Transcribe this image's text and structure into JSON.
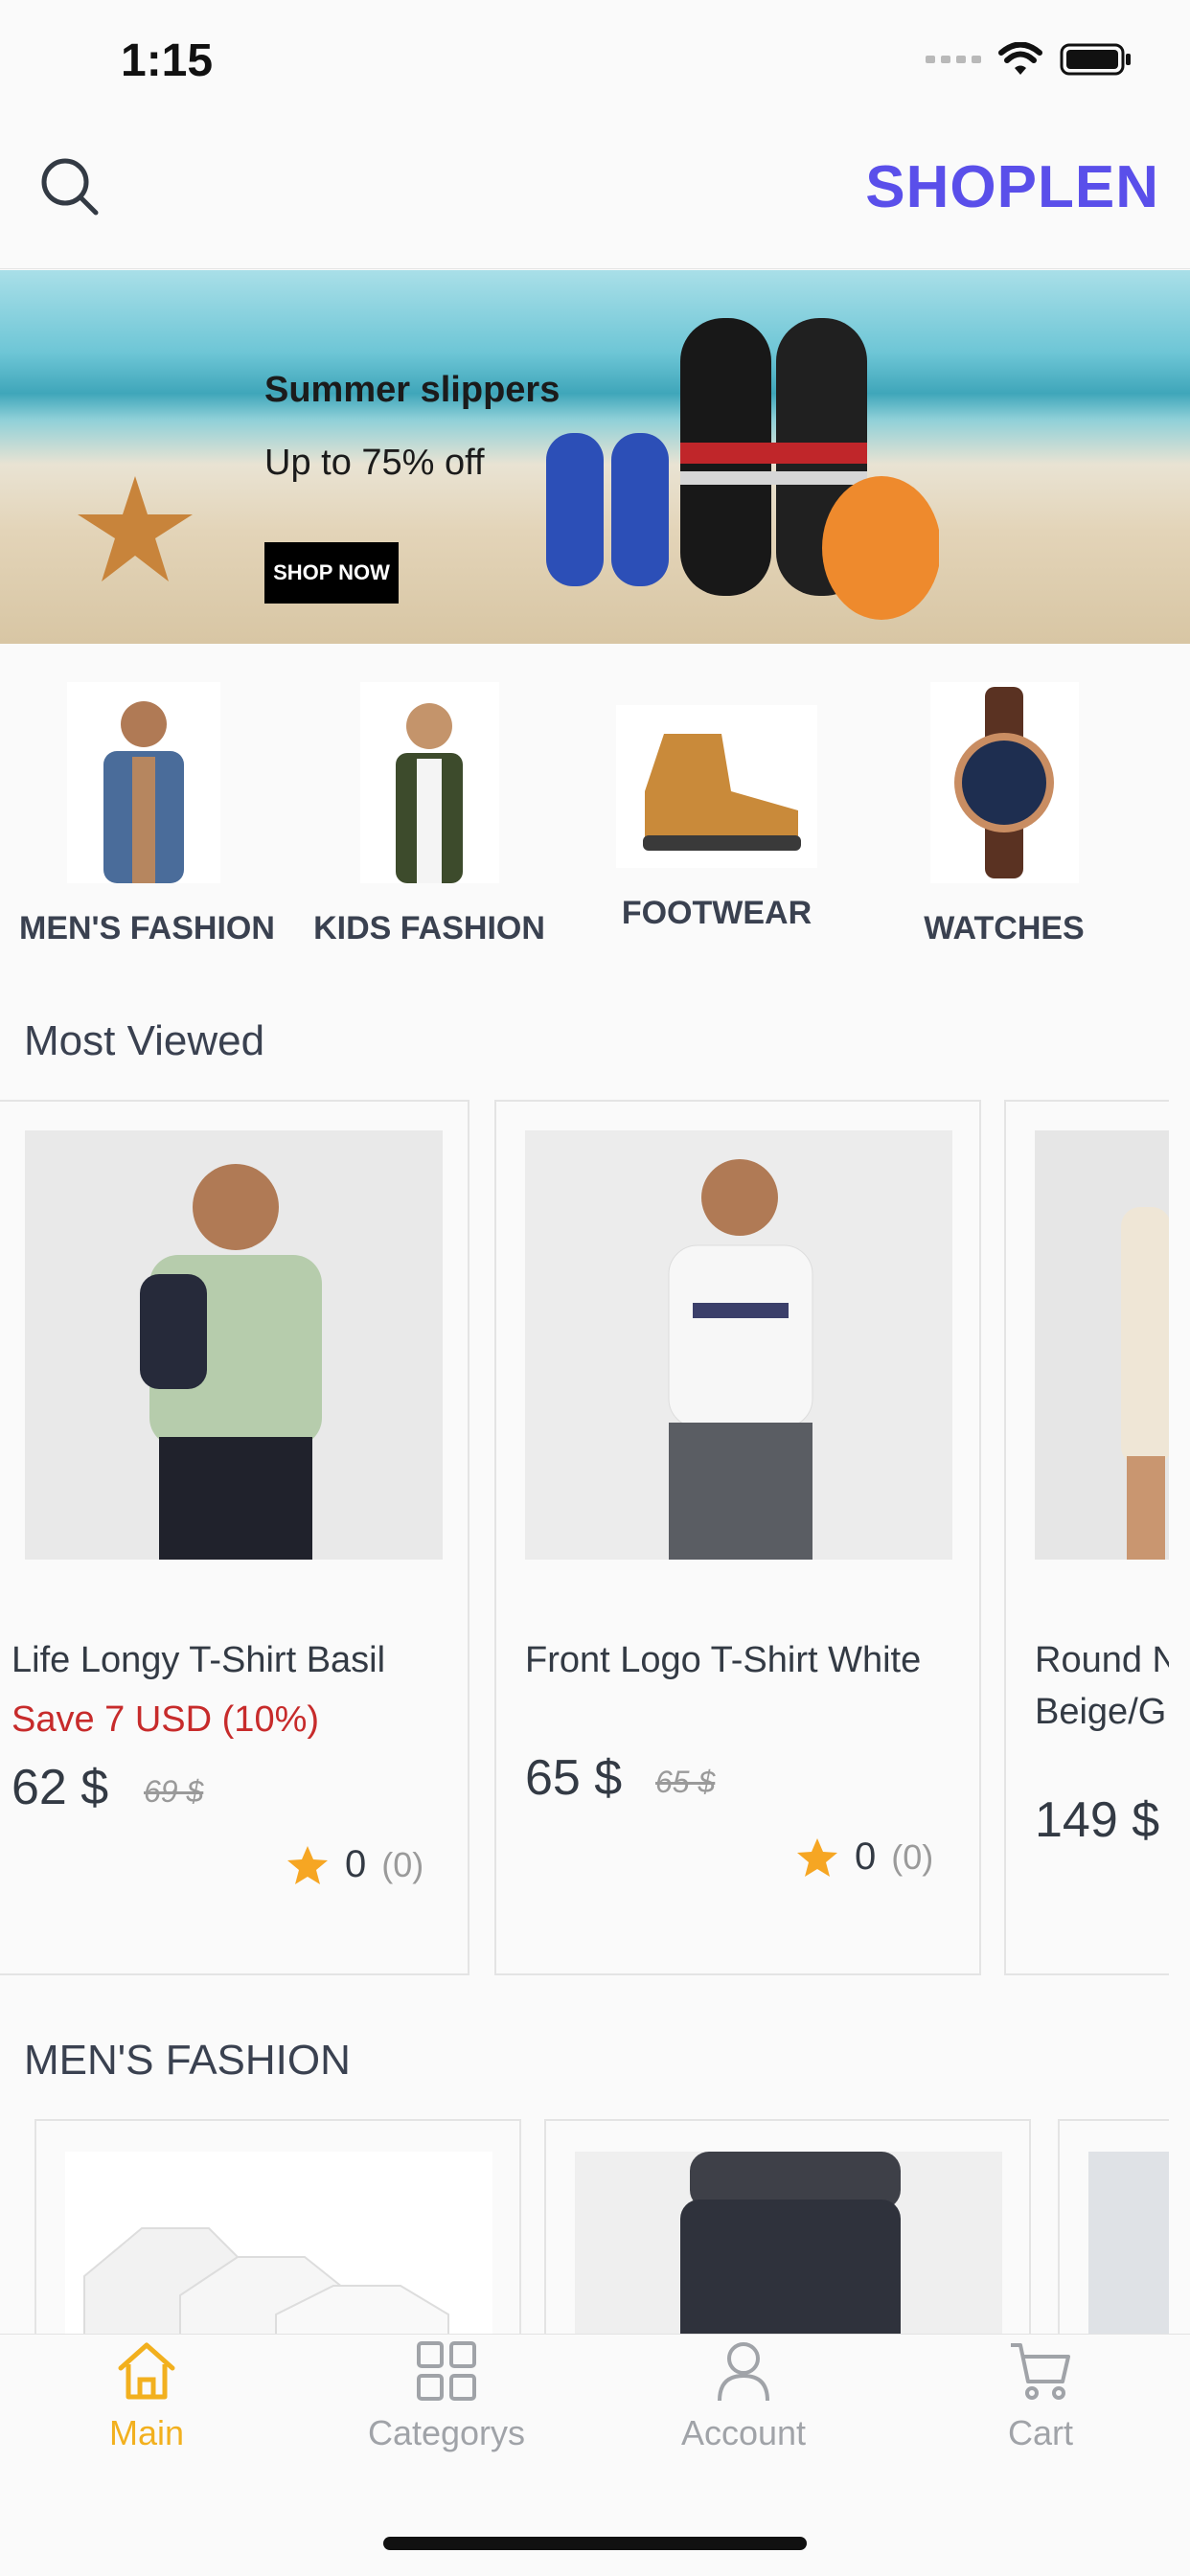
{
  "status_bar": {
    "time": "1:15"
  },
  "header": {
    "brand": "SHOPLEN"
  },
  "banner": {
    "title": "Summer slippers",
    "subtitle": "Up to 75% off",
    "cta": "SHOP NOW"
  },
  "categories": [
    {
      "label": "MEN'S FASHION"
    },
    {
      "label": "KIDS FASHION"
    },
    {
      "label": "FOOTWEAR"
    },
    {
      "label": "WATCHES"
    }
  ],
  "most_viewed": {
    "title": "Most Viewed",
    "products": [
      {
        "name": "Life Longy T-Shirt Basil",
        "save": "Save 7 USD (10%)",
        "price": "62 $",
        "old_price": "69 $",
        "rating": "0",
        "rating_count": "(0)"
      },
      {
        "name": "Front Logo T-Shirt White",
        "price": "65 $",
        "old_price": "65 $",
        "rating": "0",
        "rating_count": "(0)"
      },
      {
        "name_line1": "Round N",
        "name_line2": "Beige/G",
        "price": "149 $"
      }
    ]
  },
  "mens_fashion": {
    "title": "MEN'S FASHION"
  },
  "tabbar": {
    "items": [
      {
        "label": "Main",
        "active": true
      },
      {
        "label": "Categorys"
      },
      {
        "label": "Account"
      },
      {
        "label": "Cart"
      }
    ]
  },
  "colors": {
    "brand": "#5a4fea",
    "active_tab": "#f2b01e",
    "sale": "#c72b2b",
    "star": "#f6a623"
  }
}
